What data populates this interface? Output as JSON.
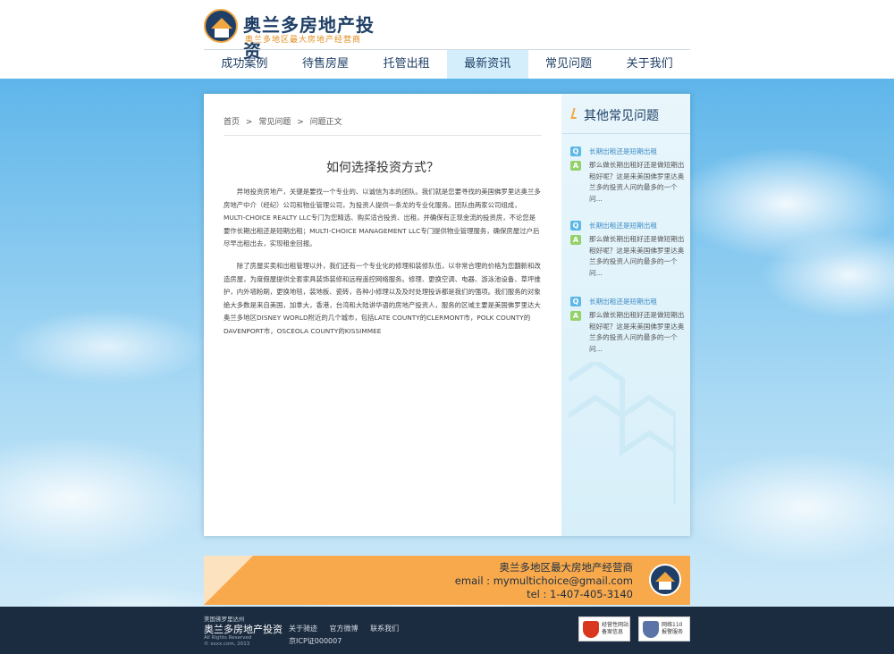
{
  "header": {
    "logo_title": "奥兰多房地产投资",
    "logo_subtitle": "奥兰多地区最大房地产经营商"
  },
  "nav": {
    "items": [
      {
        "label": "成功案例"
      },
      {
        "label": "待售房屋"
      },
      {
        "label": "托管出租"
      },
      {
        "label": "最新资讯"
      },
      {
        "label": "常见问题"
      },
      {
        "label": "关于我们"
      }
    ],
    "active_index": 3
  },
  "breadcrumb": {
    "home": "首页",
    "sep": ">",
    "section": "常见问题",
    "current": "问题正文"
  },
  "article": {
    "title": "如何选择投资方式？",
    "paragraphs": [
      "异地投资房地产，关键是要找一个专业的、以诚信为本的团队。我们就是您要寻找的美国佛罗里达奥兰多房地产中介（经纪）公司和物业管理公司，为投资人提供一条龙的专业化服务。团队由两家公司组成，MULTI-CHOICE REALTY LLC专门为您精选、购买适合投资、出租，并确保有正现金流的投资房，不论您是要作长期出租还是短期出租；MULTI-CHOICE MANAGEMENT LLC专门提供物业管理服务，确保房屋过户后尽早出租出去，实现租金回报。",
      "除了房屋买卖和出租管理以外，我们还有一个专业化的修理和装修队伍，以非常合理的价格为您翻新和改造房屋，为度假屋提供全套家具装饰装修和远程遥控网络服务。修理、更换空调、电器、游泳池设备、草坪维护，内外墙粉刷，更换地毯，装地板、瓷砖，各种小修理以及及时处理投诉都是我们的强项。我们服务的对象绝大多数是来自美国，加拿大，香港，台湾和大陆讲华语的房地产投资人，服务的区域主要是美国佛罗里达大奥兰多地区DISNEY WORLD附近的几个城市，包括LATE COUNTY的CLERMONT市，POLK COUNTY的DAVENPORT市，OSCEOLA COUNTY的KISSIMMEE"
    ]
  },
  "sidebar": {
    "title": "其他常见问题",
    "q_badge": "Q",
    "a_badge": "A",
    "items": [
      {
        "question": "长期出租还是短期出租",
        "answer": "那么做长期出租好还是做短期出租好呢？这是来美国佛罗里达奥兰多的投资人问的最多的一个问..."
      },
      {
        "question": "长期出租还是短期出租",
        "answer": "那么做长期出租好还是做短期出租好呢？这是来美国佛罗里达奥兰多的投资人问的最多的一个问..."
      },
      {
        "question": "长期出租还是短期出租",
        "answer": "那么做长期出租好还是做短期出租好呢？这是来美国佛罗里达奥兰多的投资人问的最多的一个问..."
      }
    ]
  },
  "banner": {
    "line1": "奥兰多地区最大房地产经营商",
    "line2": "email : mymultichoice@gmail.com",
    "line3": "tel : 1-407-405-3140"
  },
  "footer": {
    "region": "美国佛罗里达州",
    "brand": "奥兰多房地产投资",
    "rights": "All Rights Reserved",
    "copyright": "© xxxx.com, 2013",
    "links": [
      "关于骑迹",
      "官方微博",
      "联系我们"
    ],
    "icp": "京ICP证000007",
    "seals": [
      {
        "line1": "经营性网站",
        "line2": "备案信息"
      },
      {
        "line1": "网络110",
        "line2": "报警服务"
      }
    ]
  },
  "colors": {
    "brand_navy": "#1f3f66",
    "brand_orange": "#f7a94b",
    "nav_active_bg": "#d5eefb",
    "footer_bg": "#1c2c40",
    "link_blue": "#3a8ac4"
  },
  "icons": [
    "logo-house-icon",
    "breadcrumb-chevron-icon",
    "sidebar-heading-icon",
    "q-badge-icon",
    "a-badge-icon",
    "seal-shield-icon"
  ]
}
